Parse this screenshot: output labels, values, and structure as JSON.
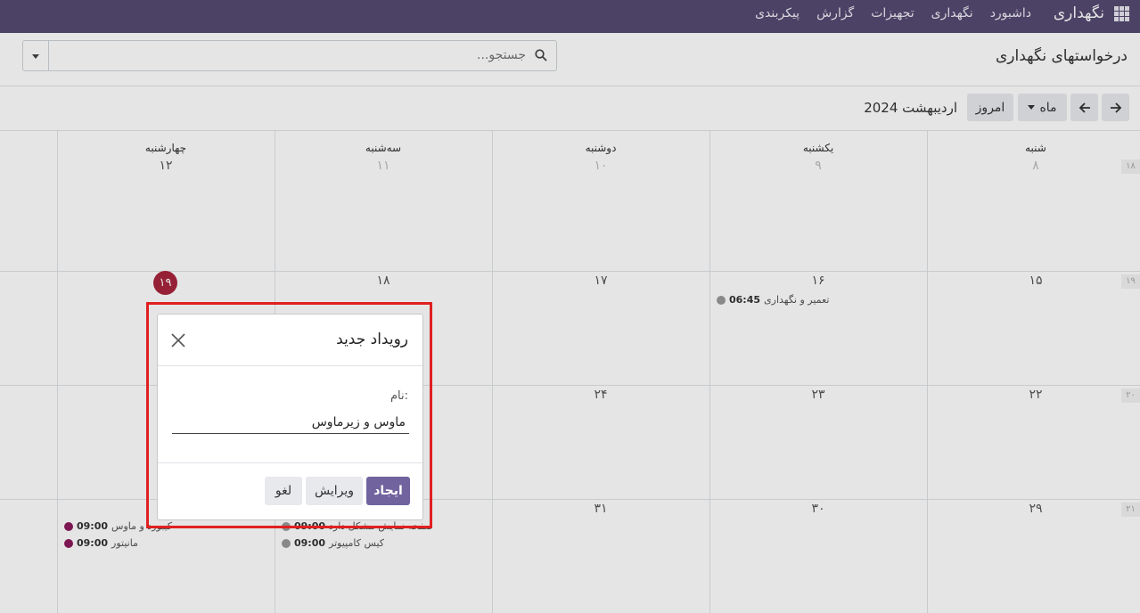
{
  "topbar": {
    "app_name": "نگهداری",
    "menu": [
      "داشبورد",
      "نگهداری",
      "تجهیزات",
      "گزارش",
      "پیکربندی"
    ]
  },
  "control": {
    "page_title": "درخواستهای نگهداری",
    "search_placeholder": "جستجو..."
  },
  "calendar_toolbar": {
    "period_title": "اردیبهشت 2024",
    "today_label": "امروز",
    "scale_label": "ماه"
  },
  "calendar": {
    "day_headers": [
      "شنبه",
      "یکشنبه",
      "دوشنبه",
      "سه‌شنبه",
      "چهارشنبه"
    ],
    "week_numbers": [
      "۱۸",
      "۱۹",
      "۲۰",
      "۲۱"
    ],
    "weeks": [
      [
        "۸",
        "۹",
        "۱۰",
        "۱۱",
        "۱۲"
      ],
      [
        "۱۵",
        "۱۶",
        "۱۷",
        "۱۸",
        "۱۹"
      ],
      [
        "۲۲",
        "۲۳",
        "۲۴",
        "",
        ""
      ],
      [
        "۲۹",
        "۳۰",
        "۳۱",
        "",
        ""
      ]
    ],
    "events": [
      {
        "time": "06:45",
        "title": "تعمیر و نگهداری"
      },
      {
        "time": "09:00",
        "title": "صفحه نمایش مشکل دارد"
      },
      {
        "time": "09:00",
        "title": "کیس کامپیوتر"
      },
      {
        "time": "09:00",
        "title": "کیبورد و ماوس"
      },
      {
        "time": "09:00",
        "title": "مانیتور"
      }
    ],
    "colors": {
      "event_gray": "#999999",
      "event_purple": "#8b1a5c",
      "today": "#a8243c"
    }
  },
  "popover": {
    "title": "رویداد جدید",
    "field_label": "نام:",
    "field_value": "ماوس و زیرماوس",
    "create_label": "ایجاد",
    "edit_label": "ویرایش",
    "cancel_label": "لغو"
  },
  "colors": {
    "primary": "#71639e",
    "topbar": "#544a72",
    "highlight": "#e02020"
  }
}
